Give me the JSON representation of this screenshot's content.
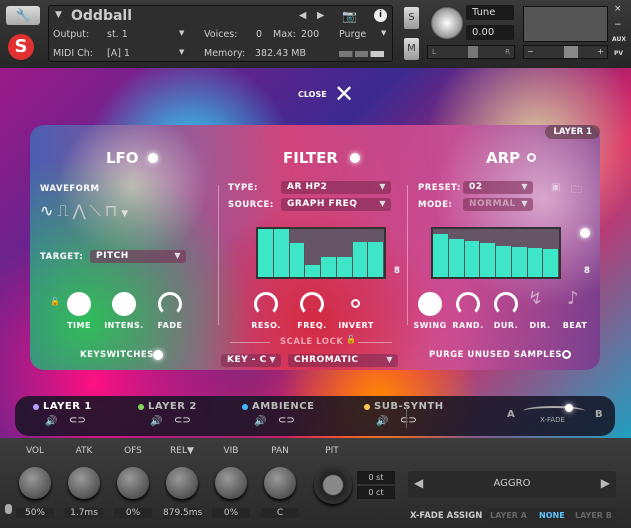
{
  "header": {
    "instrument": "Oddball",
    "output_label": "Output:",
    "output": "st. 1",
    "voices_label": "Voices:",
    "voices": "0",
    "max_label": "Max:",
    "max": "200",
    "midi_label": "MIDI Ch:",
    "midi": "[A] 1",
    "memory_label": "Memory:",
    "memory": "382.43 MB",
    "purge": "Purge",
    "solo": "S",
    "mute": "M",
    "tune_label": "Tune",
    "tune": "0.00",
    "pan_l": "L",
    "pan_r": "R",
    "vol_minus": "−",
    "vol_plus": "+",
    "close_x": "×",
    "min": "−",
    "aux": "AUX",
    "pv": "PV"
  },
  "close_label": "CLOSE",
  "layer_badge": "LAYER 1",
  "lfo": {
    "title": "LFO",
    "waveform_label": "WAVEFORM",
    "target_label": "TARGET:",
    "target": "PITCH",
    "knobs": [
      "TIME",
      "INTENS.",
      " FADE"
    ],
    "keyswitches": "KEYSWITCHES"
  },
  "filter": {
    "title": "FILTER",
    "type_label": "TYPE:",
    "type": "AR HP2",
    "source_label": "SOURCE:",
    "source": "GRAPH FREQ",
    "steps": "8",
    "step_values": [
      1,
      1,
      0.7,
      0.25,
      0.42,
      0.42,
      0.73,
      0.73
    ],
    "knobs": [
      "RESO.",
      "FREQ.",
      "INVERT"
    ],
    "scale_lock": "SCALE LOCK",
    "key": "KEY - C",
    "scale": "CHROMATIC"
  },
  "arp": {
    "title": "ARP",
    "preset_label": "PRESET:",
    "preset": "02",
    "mode_label": "MODE:",
    "mode": "NORMAL",
    "steps": "8",
    "step_values": [
      0.9,
      0.8,
      0.76,
      0.7,
      0.65,
      0.63,
      0.61,
      0.59
    ],
    "knobs": [
      "SWING",
      "RAND.",
      "DUR.",
      "DIR.",
      "BEAT"
    ],
    "purge": "PURGE UNUSED SAMPLES"
  },
  "layers": [
    {
      "name": "LAYER 1",
      "color": "#b0a0ff"
    },
    {
      "name": "LAYER 2",
      "color": "#7ed957"
    },
    {
      "name": "AMBIENCE",
      "color": "#40b8ff"
    },
    {
      "name": "SUB-SYNTH",
      "color": "#ffc857"
    }
  ],
  "xfade": {
    "a": "A",
    "b": "B",
    "label": "X-FADE"
  },
  "controls": [
    {
      "label": "VOL",
      "value": "50%"
    },
    {
      "label": "ATK",
      "value": "1.7ms"
    },
    {
      "label": "OFS",
      "value": "0%"
    },
    {
      "label": "REL▼",
      "value": "879.5ms"
    },
    {
      "label": "VIB",
      "value": "0%"
    },
    {
      "label": "PAN",
      "value": "C"
    }
  ],
  "pitch": {
    "label": "PIT",
    "st": "0 st",
    "ct": "0 ct"
  },
  "preset_nav": {
    "name": "AGGRO"
  },
  "xfade_assign": {
    "label": "X-FADE ASSIGN",
    "options": [
      "LAYER A",
      "NONE",
      "LAYER B"
    ],
    "selected": "NONE"
  }
}
